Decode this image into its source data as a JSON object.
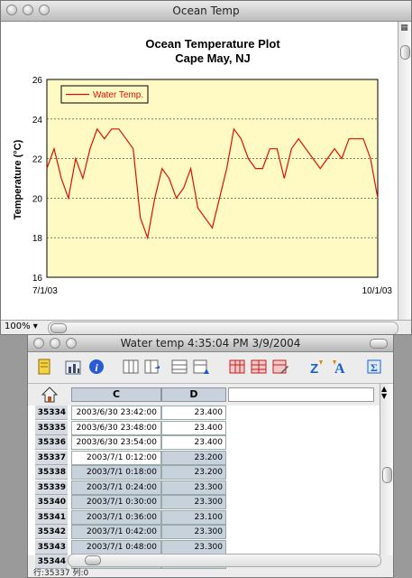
{
  "chart_window": {
    "title": "Ocean Temp",
    "zoom": "100%"
  },
  "chart_data": {
    "type": "line",
    "title": "Ocean Temperature Plot",
    "subtitle": "Cape May, NJ",
    "ylabel": "Temperature (°C)",
    "xlabel": "",
    "x_ticks": [
      "7/1/03",
      "10/1/03"
    ],
    "ylim": [
      16,
      26
    ],
    "y_ticks": [
      16,
      18,
      20,
      22,
      24,
      26
    ],
    "xlim": [
      "2003-07-01",
      "2003-10-01"
    ],
    "grid": true,
    "legend_position": "top-left",
    "background": "#fff9c4",
    "series": [
      {
        "name": "Water Temp.",
        "color": "#dd1100",
        "x": [
          "2003-07-01",
          "2003-07-03",
          "2003-07-05",
          "2003-07-07",
          "2003-07-09",
          "2003-07-11",
          "2003-07-13",
          "2003-07-15",
          "2003-07-17",
          "2003-07-19",
          "2003-07-21",
          "2003-07-23",
          "2003-07-25",
          "2003-07-27",
          "2003-07-29",
          "2003-07-31",
          "2003-08-02",
          "2003-08-04",
          "2003-08-06",
          "2003-08-08",
          "2003-08-10",
          "2003-08-12",
          "2003-08-14",
          "2003-08-16",
          "2003-08-18",
          "2003-08-20",
          "2003-08-22",
          "2003-08-24",
          "2003-08-26",
          "2003-08-28",
          "2003-08-30",
          "2003-09-01",
          "2003-09-03",
          "2003-09-05",
          "2003-09-07",
          "2003-09-09",
          "2003-09-11",
          "2003-09-13",
          "2003-09-15",
          "2003-09-17",
          "2003-09-19",
          "2003-09-21",
          "2003-09-23",
          "2003-09-25",
          "2003-09-27",
          "2003-09-29",
          "2003-10-01"
        ],
        "values": [
          21.5,
          22.5,
          21.0,
          20.0,
          22.0,
          21.0,
          22.5,
          23.5,
          23.0,
          23.5,
          23.5,
          23.0,
          22.5,
          19.0,
          18.0,
          20.0,
          21.5,
          21.0,
          20.0,
          20.5,
          21.5,
          19.5,
          19.0,
          18.5,
          20.0,
          21.5,
          23.5,
          23.0,
          22.0,
          21.5,
          21.5,
          22.5,
          22.5,
          21.0,
          22.5,
          23.0,
          22.5,
          22.0,
          21.5,
          22.0,
          22.5,
          22.0,
          23.0,
          23.0,
          23.0,
          22.0,
          20.0
        ]
      }
    ]
  },
  "table_window": {
    "title": "Water temp 4:35:04 PM 3/9/2004",
    "columns": [
      "C",
      "D"
    ],
    "rows": [
      {
        "num": "35334",
        "c": "2003/6/30 23:42:00",
        "d": "23.400",
        "selected": false
      },
      {
        "num": "35335",
        "c": "2003/6/30 23:48:00",
        "d": "23.400",
        "selected": false
      },
      {
        "num": "35336",
        "c": "2003/6/30 23:54:00",
        "d": "23.400",
        "selected": false
      },
      {
        "num": "35337",
        "c": "2003/7/1 0:12:00",
        "d": "23.200",
        "selected": true
      },
      {
        "num": "35338",
        "c": "2003/7/1 0:18:00",
        "d": "23.200",
        "selected": true
      },
      {
        "num": "35339",
        "c": "2003/7/1 0:24:00",
        "d": "23.300",
        "selected": true
      },
      {
        "num": "35340",
        "c": "2003/7/1 0:30:00",
        "d": "23.300",
        "selected": true
      },
      {
        "num": "35341",
        "c": "2003/7/1 0:36:00",
        "d": "23.100",
        "selected": true
      },
      {
        "num": "35342",
        "c": "2003/7/1 0:42:00",
        "d": "23.300",
        "selected": true
      },
      {
        "num": "35343",
        "c": "2003/7/1 0:48:00",
        "d": "23.300",
        "selected": true
      },
      {
        "num": "35344",
        "c": "",
        "d": "",
        "selected": true
      }
    ],
    "status": "行:35337  列:0"
  },
  "icons": [
    "notepad-icon",
    "chart-icon",
    "info-icon",
    "insert-column-icon",
    "delete-column-icon",
    "insert-row-icon",
    "delete-row-icon",
    "table-icon",
    "table2-icon",
    "table-edit-icon",
    "sort-az-icon",
    "font-icon",
    "column-width-icon",
    "home-icon"
  ]
}
